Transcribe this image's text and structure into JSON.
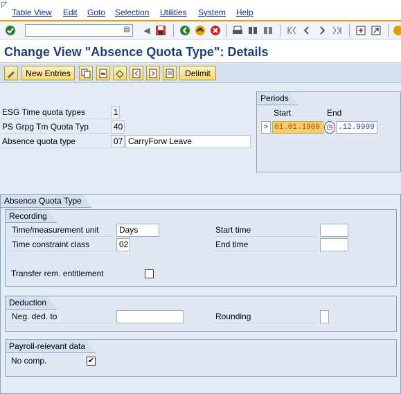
{
  "menu": [
    "Table View",
    "Edit",
    "Goto",
    "Selection",
    "Utilities",
    "System",
    "Help"
  ],
  "title": "Change View \"Absence Quota Type\": Details",
  "toolbar": {
    "new_entries": "New Entries",
    "delimit": "Delimit"
  },
  "keys": {
    "esg_label": "ESG Time quota types",
    "esg_value": "1",
    "psgrpg_label": "PS Grpg Tm Quota Typ",
    "psgrpg_value": "40",
    "absence_label": "Absence quota type",
    "absence_value": "07",
    "absence_text": "CarryForw Leave"
  },
  "periods": {
    "title": "Periods",
    "start_label": "Start",
    "end_label": "End",
    "start_value": "01.01.1900",
    "end_value": ".12.9999",
    "marker": ">"
  },
  "section_title": "Absence Quota Type",
  "recording": {
    "title": "Recording",
    "time_unit_label": "Time/measurement unit",
    "time_unit_value": "Days",
    "constraint_label": "Time constraint class",
    "constraint_value": "02",
    "start_time_label": "Start time",
    "end_time_label": "End time",
    "transfer_label": "Transfer rem. entitlement"
  },
  "deduction": {
    "title": "Deduction",
    "neg_label": "Neg. ded. to",
    "rounding_label": "Rounding"
  },
  "payroll": {
    "title": "Payroll-relevant data",
    "nocomp_label": "No comp.",
    "nocomp_check": "✔"
  },
  "colors": {
    "title": "#1e3f78",
    "accent": "#f0a000",
    "button": "#f4d873"
  }
}
